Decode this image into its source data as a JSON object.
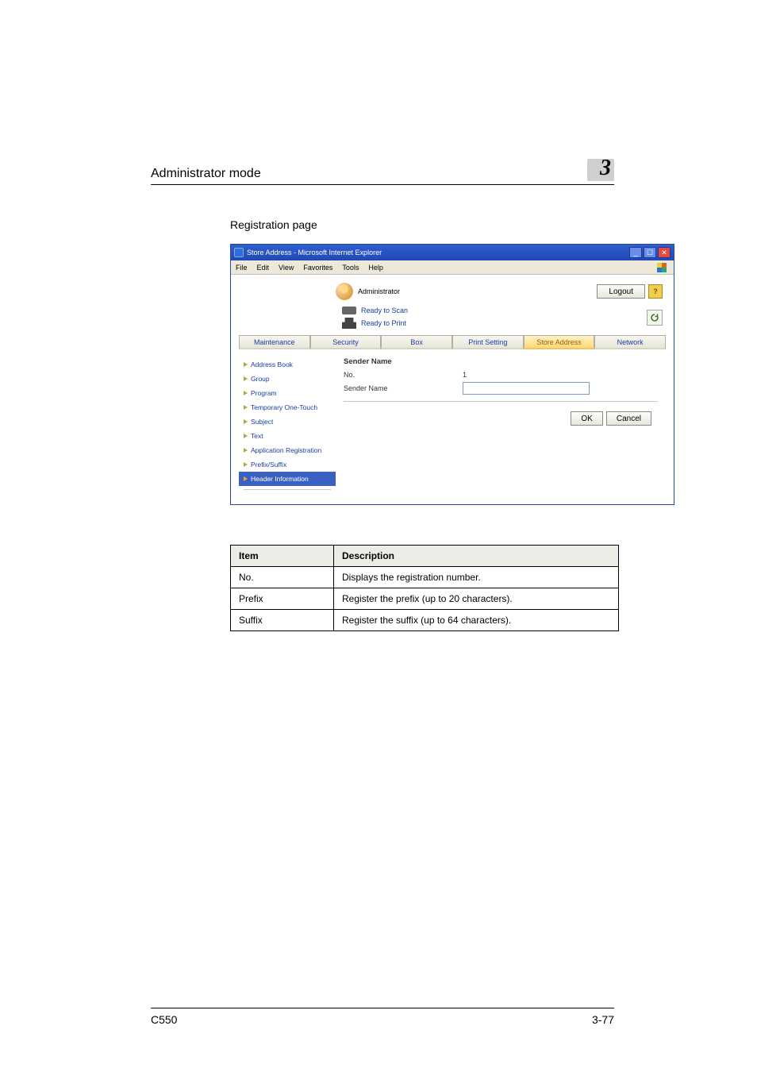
{
  "header": {
    "title": "Administrator mode",
    "chapter": "3"
  },
  "section_title": "Registration page",
  "browser": {
    "window_title": "Store Address - Microsoft Internet Explorer",
    "menu": {
      "file": "File",
      "edit": "Edit",
      "view": "View",
      "favorites": "Favorites",
      "tools": "Tools",
      "help": "Help"
    },
    "admin_label": "Administrator",
    "logout": "Logout",
    "status": {
      "scan": "Ready to Scan",
      "print": "Ready to Print"
    },
    "tabs": {
      "maintenance": "Maintenance",
      "security": "Security",
      "box": "Box",
      "print": "Print Setting",
      "store": "Store Address",
      "network": "Network"
    },
    "sidenav": {
      "address_book": "Address Book",
      "group": "Group",
      "program": "Program",
      "temporary": "Temporary One-Touch",
      "subject": "Subject",
      "text": "Text",
      "app_reg": "Application Registration",
      "prefix": "Prefix/Suffix",
      "header_info": "Header Information"
    },
    "form": {
      "title": "Sender Name",
      "no_label": "No.",
      "no_value": "1",
      "name_label": "Sender Name",
      "ok": "OK",
      "cancel": "Cancel"
    }
  },
  "table": {
    "h1": "Item",
    "h2": "Description",
    "rows": [
      {
        "item": "No.",
        "desc": "Displays the registration number."
      },
      {
        "item": "Prefix",
        "desc": "Register the prefix (up to 20 characters)."
      },
      {
        "item": "Suffix",
        "desc": "Register the suffix (up to 64 characters)."
      }
    ]
  },
  "footer": {
    "left": "C550",
    "right": "3-77"
  }
}
